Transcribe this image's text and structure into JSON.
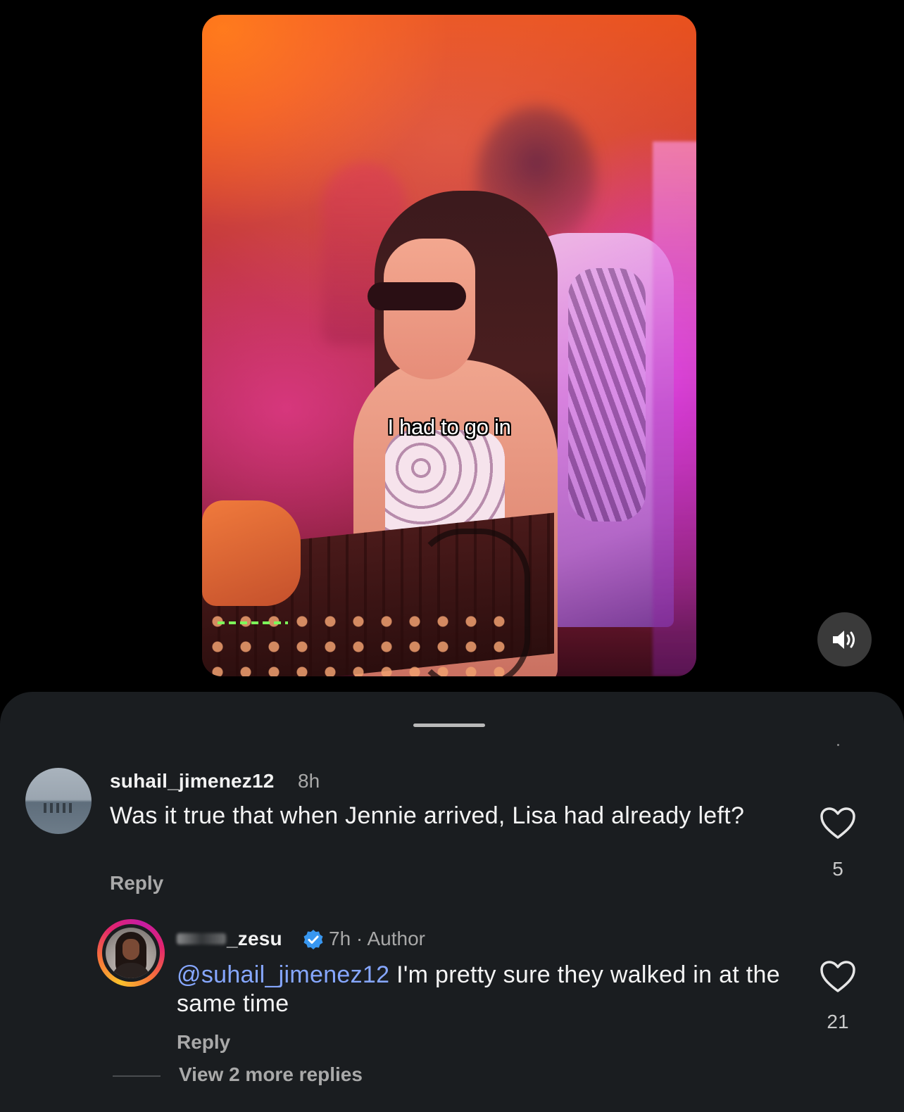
{
  "video": {
    "caption": "I had to go in"
  },
  "comments": [
    {
      "username": "suhail_jimenez12",
      "time": "8h",
      "text": "Was it true that when Jennie arrived, Lisa had already left?",
      "reply_label": "Reply",
      "likes": "5"
    }
  ],
  "reply": {
    "username": "_zesu",
    "meta": "7h · Author",
    "mention": "@suhail_jimenez12",
    "text": " I'm pretty sure they walked in at the same time",
    "reply_label": "Reply",
    "likes": "21",
    "view_more": "View 2 more replies"
  },
  "icons": {
    "sound": "speaker-on-icon",
    "like": "heart-outline-icon",
    "verified": "verified-badge-icon"
  },
  "colors": {
    "sheet_background": "#1a1d20",
    "mention": "#86a7ff",
    "verified": "#3897f0"
  }
}
